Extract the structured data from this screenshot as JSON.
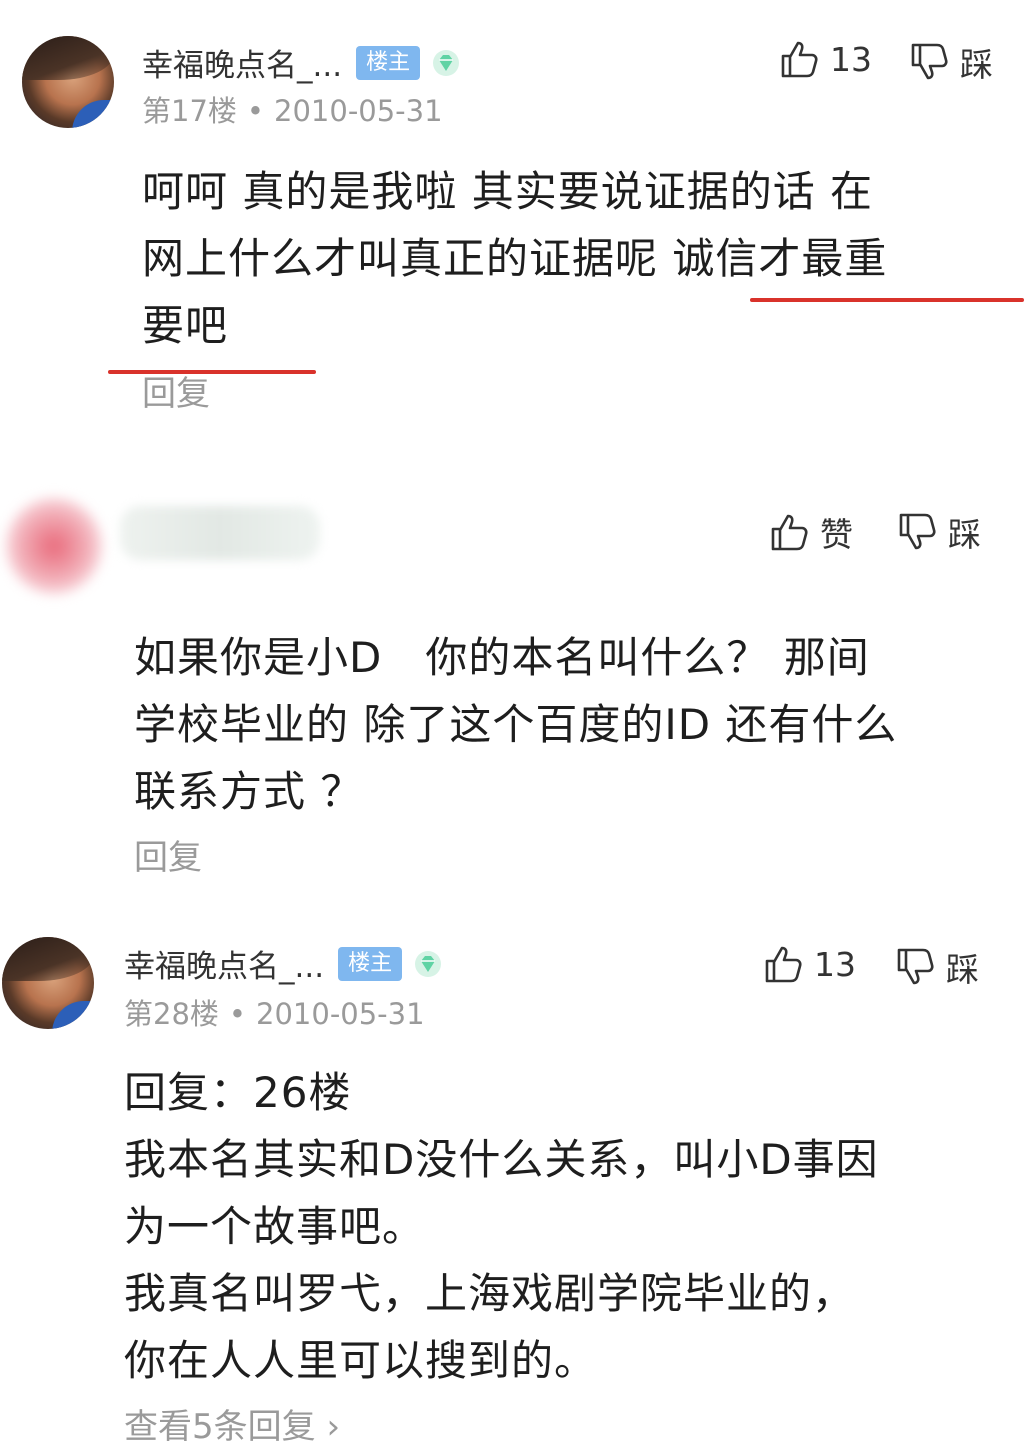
{
  "post1": {
    "username": "幸福晚点名_...",
    "badge": "楼主",
    "floor": "第17楼",
    "dot": "•",
    "date": "2010-05-31",
    "like_count": "13",
    "dislike_label": "踩",
    "content_lines": [
      "呵呵 真的是我啦 其实要说证据的话 在",
      "网上什么才叫真正的证据呢 诚信才最重",
      "要吧"
    ],
    "reply_label": "回复"
  },
  "post2": {
    "like_label": "赞",
    "dislike_label": "踩",
    "content_lines": [
      "如果你是小D　你的本名叫什么？ 那间",
      "学校毕业的 除了这个百度的ID 还有什么",
      "联系方式 ？"
    ],
    "reply_label": "回复"
  },
  "post3": {
    "username": "幸福晚点名_...",
    "badge": "楼主",
    "floor": "第28楼",
    "dot": "•",
    "date": "2010-05-31",
    "like_count": "13",
    "dislike_label": "踩",
    "content_lines": [
      "回复：26楼",
      "我本名其实和D没什么关系，叫小D事因",
      "为一个故事吧。",
      "我真名叫罗弋，上海戏剧学院毕业的，",
      "你在人人里可以搜到的。"
    ],
    "view_replies_label": "查看5条回复 ›"
  },
  "colors": {
    "badge": "#7fb7ef",
    "diamond": "#5fd3a4",
    "highlight_underline": "#d9322b",
    "meta_text": "#9a9a9a"
  },
  "icons": {
    "like": "thumbs-up-icon",
    "dislike": "thumbs-down-icon",
    "vip": "diamond-icon"
  }
}
